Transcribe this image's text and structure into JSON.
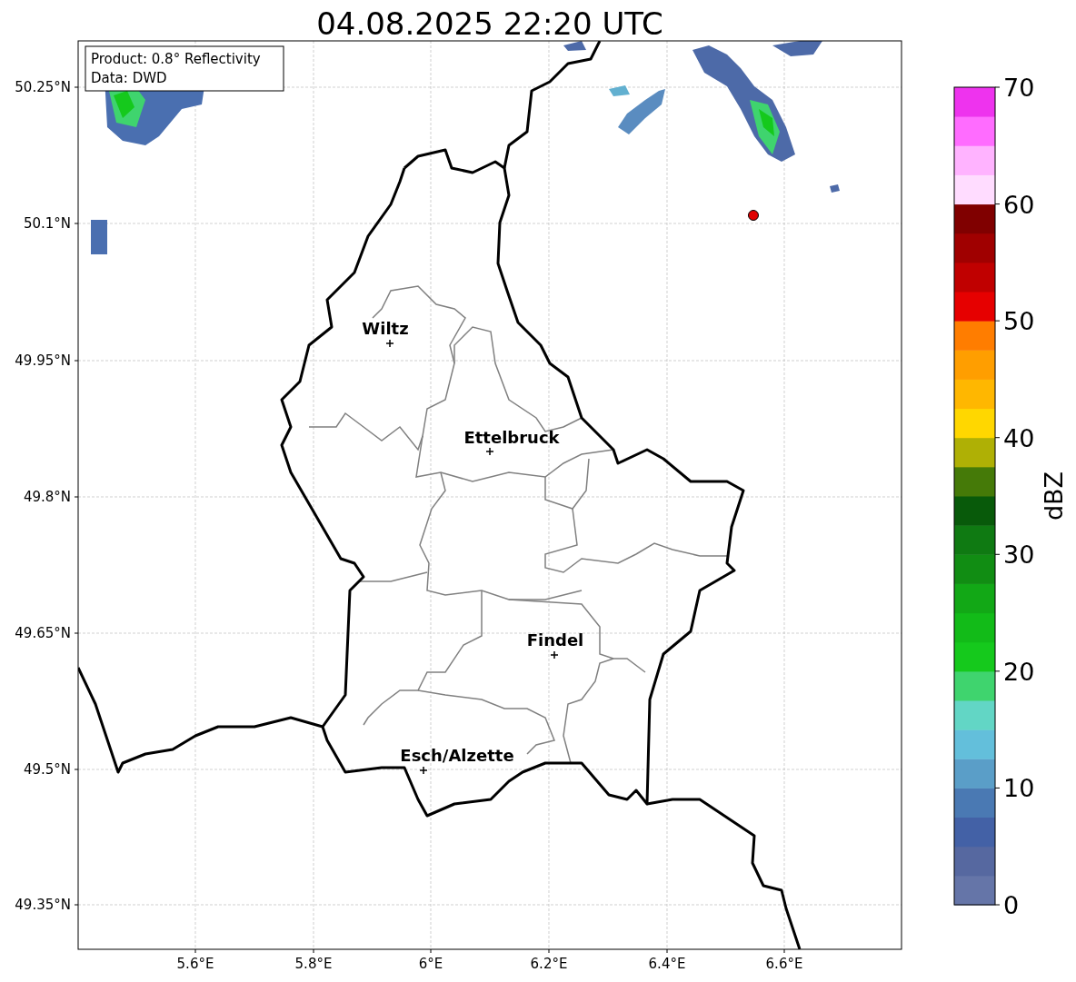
{
  "title": "04.08.2025 22:20 UTC",
  "info_box": [
    "Product: 0.8° Reflectivity",
    "Data: DWD"
  ],
  "map": {
    "yticks": [
      "50.25°N",
      "50.1°N",
      "49.95°N",
      "49.8°N",
      "49.65°N",
      "49.5°N",
      "49.35°N"
    ],
    "xticks": [
      "5.6°E",
      "5.8°E",
      "6°E",
      "6.2°E",
      "6.4°E",
      "6.6°E"
    ],
    "cities": [
      {
        "name": "Wiltz"
      },
      {
        "name": "Ettelbruck"
      },
      {
        "name": "Findel"
      },
      {
        "name": "Esch/Alzette"
      }
    ]
  },
  "colorbar": {
    "label": "dBZ",
    "ticks": [
      "70",
      "60",
      "50",
      "40",
      "30",
      "20",
      "10",
      "0"
    ],
    "bins": [
      {
        "color": "#6575a8"
      },
      {
        "color": "#5668a0"
      },
      {
        "color": "#4361a6"
      },
      {
        "color": "#4a79b3"
      },
      {
        "color": "#5a9ec8"
      },
      {
        "color": "#63bfdb"
      },
      {
        "color": "#62d6c5"
      },
      {
        "color": "#3fd46e"
      },
      {
        "color": "#15c91c"
      },
      {
        "color": "#12bb18"
      },
      {
        "color": "#12a816"
      },
      {
        "color": "#118d13"
      },
      {
        "color": "#0f7a12"
      },
      {
        "color": "#085a0a"
      },
      {
        "color": "#457a08"
      },
      {
        "color": "#afb005"
      },
      {
        "color": "#ffd700"
      },
      {
        "color": "#ffb700"
      },
      {
        "color": "#ff9e00"
      },
      {
        "color": "#ff7d00"
      },
      {
        "color": "#e60000"
      },
      {
        "color": "#c00000"
      },
      {
        "color": "#a00000"
      },
      {
        "color": "#800000"
      },
      {
        "color": "#ffdcff"
      },
      {
        "color": "#ffb3ff"
      },
      {
        "color": "#ff6cff"
      },
      {
        "color": "#ee33ee"
      }
    ]
  }
}
